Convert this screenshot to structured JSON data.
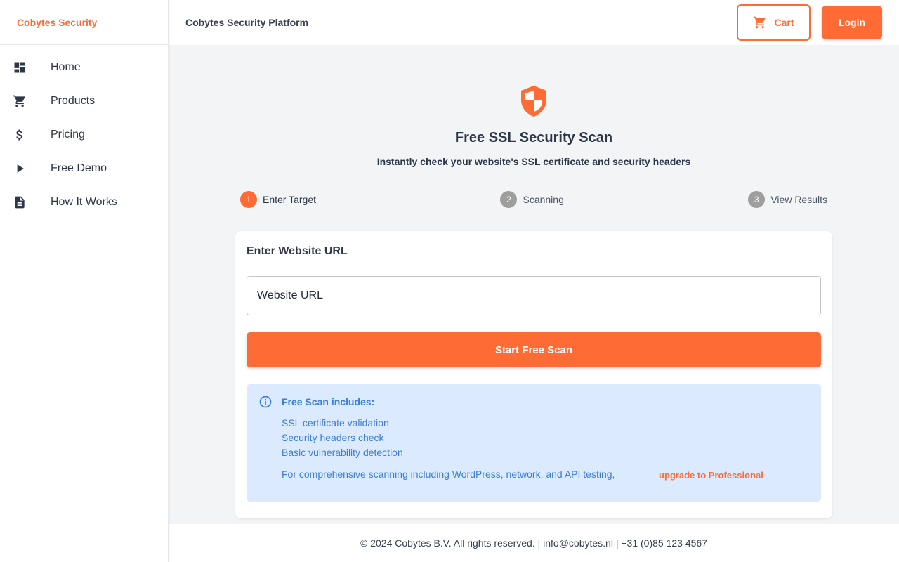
{
  "colors": {
    "accent": "#ff6b35",
    "step_inactive": "#9e9e9e",
    "info_bg": "#dbeafe",
    "info_text": "#3b7fd4"
  },
  "sidebar": {
    "brand": "Cobytes Security",
    "items": [
      {
        "label": "Home",
        "icon": "dashboard-icon"
      },
      {
        "label": "Products",
        "icon": "cart-icon"
      },
      {
        "label": "Pricing",
        "icon": "dollar-icon"
      },
      {
        "label": "Free Demo",
        "icon": "play-icon"
      },
      {
        "label": "How It Works",
        "icon": "document-icon"
      }
    ]
  },
  "header": {
    "title": "Cobytes Security Platform",
    "cart_label": "Cart",
    "login_label": "Login"
  },
  "hero": {
    "icon": "shield-icon",
    "title": "Free SSL Security Scan",
    "subtitle": "Instantly check your website's SSL certificate and security headers"
  },
  "stepper": {
    "active_step": 1,
    "steps": [
      {
        "number": "1",
        "label": "Enter Target"
      },
      {
        "number": "2",
        "label": "Scanning"
      },
      {
        "number": "3",
        "label": "View Results"
      }
    ]
  },
  "form": {
    "title": "Enter Website URL",
    "url_placeholder": "Website URL",
    "url_value": "",
    "submit_label": "Start Free Scan"
  },
  "info": {
    "icon": "info-icon",
    "title": "Free Scan includes:",
    "items": [
      "SSL certificate validation",
      "Security headers check",
      "Basic vulnerability detection"
    ],
    "note": "For comprehensive scanning including WordPress, network, and API testing,",
    "link_label": "upgrade to Professional"
  },
  "footer": {
    "text": "© 2024 Cobytes B.V. All rights reserved. | info@cobytes.nl | +31 (0)85 123 4567"
  }
}
